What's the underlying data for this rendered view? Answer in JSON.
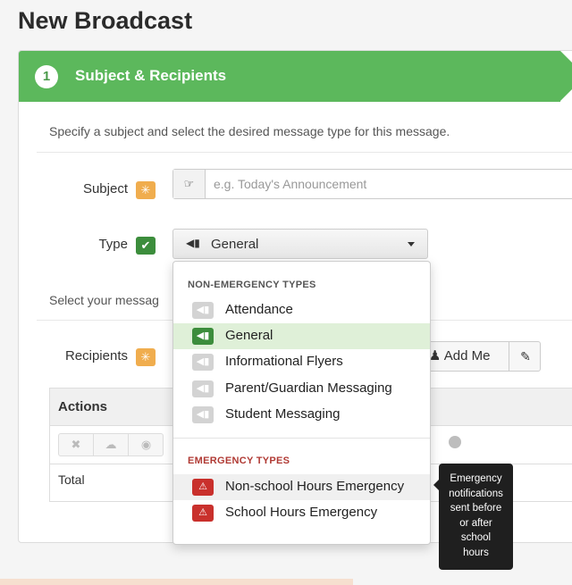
{
  "page": {
    "title": "New Broadcast"
  },
  "step": {
    "number": "1",
    "title": "Subject & Recipients"
  },
  "intro": "Specify a subject and select the desired message type for this message.",
  "subject": {
    "label": "Subject",
    "placeholder": "e.g. Today's Announcement",
    "value": ""
  },
  "type": {
    "label": "Type",
    "selected": "General"
  },
  "select_prompt": "Select your messag",
  "recipients": {
    "label": "Recipients",
    "add_me": "Add Me"
  },
  "table": {
    "header_actions": "Actions",
    "total_label": "Total"
  },
  "dropdown": {
    "non_emergency_header": "NON-EMERGENCY TYPES",
    "non_emergency": [
      "Attendance",
      "General",
      "Informational Flyers",
      "Parent/Guardian Messaging",
      "Student Messaging"
    ],
    "emergency_header": "EMERGENCY TYPES",
    "emergency": [
      "Non-school Hours Emergency",
      "School Hours Emergency"
    ]
  },
  "tooltip": {
    "lines": [
      "Emergency",
      "notifications",
      "sent before",
      "or after",
      "school",
      "hours"
    ]
  },
  "colors": {
    "step_green": "#5cb85c",
    "required_orange": "#f0ad4e",
    "valid_green": "#3c8d3c",
    "emergency_red": "#c9302c"
  },
  "icons": {
    "subject_addon": "hand-pointer-icon",
    "type_select": "megaphone-icon",
    "add_me": "user-icon",
    "edit": "pencil-icon",
    "emergency": "warning-triangle-icon"
  }
}
